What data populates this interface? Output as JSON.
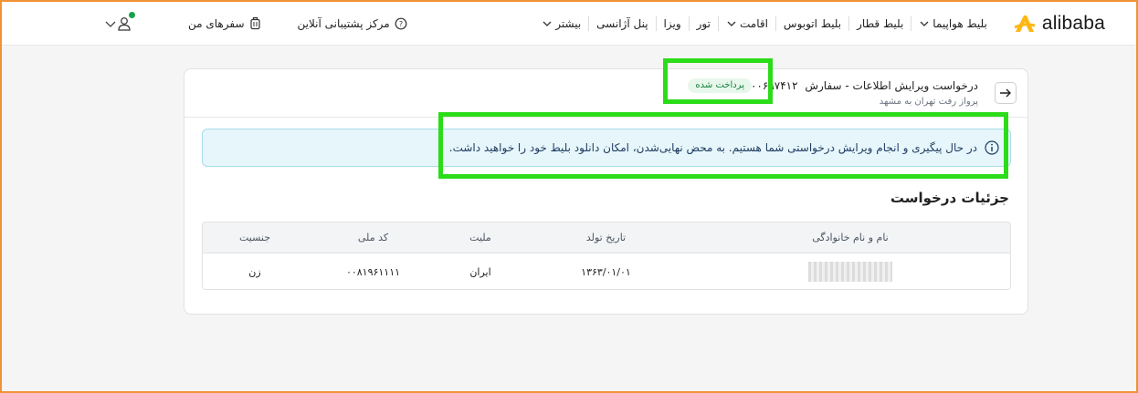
{
  "header": {
    "logo_text": "alibaba",
    "nav": [
      {
        "label": "بلیط هواپیما",
        "has_menu": true
      },
      {
        "label": "بلیط قطار",
        "has_menu": false
      },
      {
        "label": "بلیط اتوبوس",
        "has_menu": false
      },
      {
        "label": "اقامت",
        "has_menu": true
      },
      {
        "label": "تور",
        "has_menu": false
      },
      {
        "label": "ویزا",
        "has_menu": false
      },
      {
        "label": "پنل آژانسی",
        "has_menu": false
      },
      {
        "label": "بیشتر",
        "has_menu": true
      }
    ],
    "support_label": "مرکز پشتیبانی آنلاین",
    "trips_label": "سفرهای من"
  },
  "card": {
    "title": "درخواست ویرایش اطلاعات - سفارش",
    "order_number": "۷۰۰۰۰۶۹۷۴۱۲",
    "status": "پرداخت شده",
    "subtitle": "پرواز رفت تهران به مشهد",
    "info_text": "در حال پیگیری و انجام ویرایش درخواستی شما هستیم. به محض نهایی‌شدن، امکان دانلود بلیط خود را خواهید داشت.",
    "section_title": "جزئیات درخواست",
    "table": {
      "headers": {
        "name": "نام و نام خانوادگی",
        "birth": "تاریخ تولد",
        "nationality": "ملیت",
        "national_id": "کد ملی",
        "gender": "جنسیت"
      },
      "rows": [
        {
          "birth": "۱۳۶۳/۰۱/۰۱",
          "nationality": "ایران",
          "national_id": "۰۰۸۱۹۶۱۱۱۱",
          "gender": "زن"
        }
      ]
    }
  },
  "colors": {
    "accent": "#f29234",
    "logo": "#fdb713",
    "badge_bg": "#e8f7ec",
    "badge_text": "#15803d",
    "info_bg": "#e6f6fb",
    "highlight": "#2bdc18"
  }
}
